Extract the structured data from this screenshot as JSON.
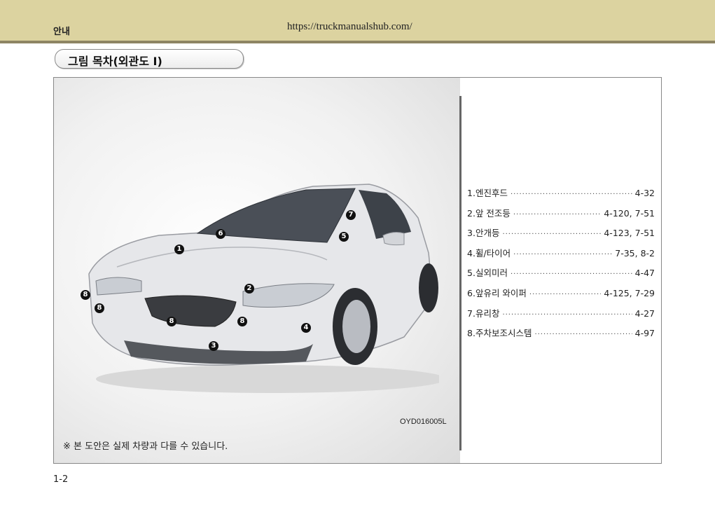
{
  "header": {
    "section": "안내",
    "url": "https://truckmanualshub.com/"
  },
  "title": "그림 목차(외관도 I)",
  "figure": {
    "image_code": "OYD016005L",
    "footnote": "※ 본 도안은 실제 차량과 다를 수 있습니다.",
    "markers": [
      {
        "label": "1"
      },
      {
        "label": "2"
      },
      {
        "label": "3"
      },
      {
        "label": "4"
      },
      {
        "label": "5"
      },
      {
        "label": "6"
      },
      {
        "label": "7"
      },
      {
        "label": "8"
      },
      {
        "label": "8"
      },
      {
        "label": "8"
      },
      {
        "label": "8"
      }
    ]
  },
  "toc": [
    {
      "num": "1.",
      "label": "엔진후드",
      "page": "4-32"
    },
    {
      "num": "2.",
      "label": "앞 전조등",
      "page": "4-120, 7-51"
    },
    {
      "num": "3.",
      "label": "안개등",
      "page": "4-123, 7-51"
    },
    {
      "num": "4.",
      "label": "휠/타이어",
      "page": "7-35, 8-2"
    },
    {
      "num": "5.",
      "label": "실외미러",
      "page": "4-47"
    },
    {
      "num": "6.",
      "label": "앞유리 와이퍼",
      "page": "4-125, 7-29"
    },
    {
      "num": "7.",
      "label": "유리창",
      "page": "4-27"
    },
    {
      "num": "8.",
      "label": "주차보조시스템",
      "page": "4-97"
    }
  ],
  "dots": "··································································",
  "page_number": "1-2"
}
